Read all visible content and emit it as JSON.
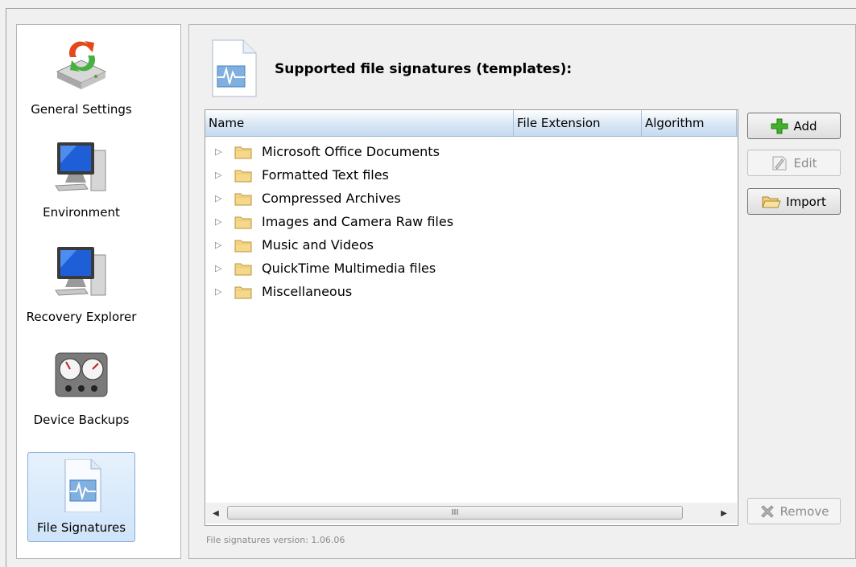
{
  "sidebar": {
    "items": [
      {
        "label": "General Settings",
        "icon": "drive-sync-icon"
      },
      {
        "label": "Environment",
        "icon": "computer-icon"
      },
      {
        "label": "Recovery Explorer",
        "icon": "computer-icon"
      },
      {
        "label": "Device Backups",
        "icon": "gauges-icon"
      },
      {
        "label": "File Signatures",
        "icon": "signature-file-icon",
        "selected": true
      }
    ]
  },
  "main": {
    "title": "Supported file signatures (templates):",
    "table": {
      "columns": [
        "Name",
        "File Extension",
        "Algorithm"
      ],
      "rows": [
        "Microsoft Office Documents",
        "Formatted Text files",
        "Compressed Archives",
        "Images and Camera Raw files",
        "Music and Videos",
        "QuickTime Multimedia files",
        "Miscellaneous"
      ],
      "scroll_thumb_label": "III"
    },
    "buttons": {
      "add": "Add",
      "edit": "Edit",
      "import": "Import",
      "remove": "Remove"
    },
    "version_text": "File signatures version: 1.06.06"
  },
  "colors": {
    "selection_bg": "#cfe4fa",
    "selection_border": "#84acdd",
    "header_bg": "#dbe8f5"
  }
}
